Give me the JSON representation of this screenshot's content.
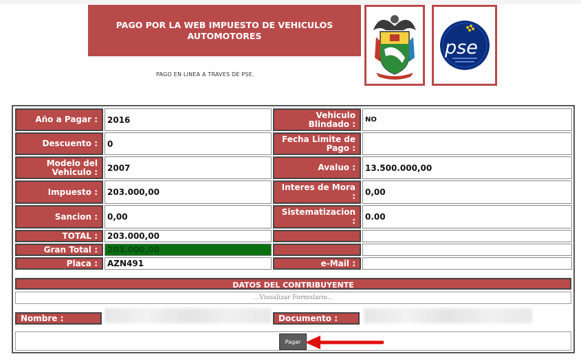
{
  "header": {
    "title": "PAGO POR LA WEB IMPUESTO DE VEHICULOS AUTOMOTORES",
    "subtitle": "PAGO EN LINEA A TRAVES DE PSE.",
    "pse_logo_text": "pse"
  },
  "form": {
    "left": [
      {
        "label": "Año a Pagar :",
        "value": "2016"
      },
      {
        "label": "Descuento :",
        "value": "0"
      },
      {
        "label": "Modelo del Vehiculo :",
        "value": "2007"
      },
      {
        "label": "Impuesto :",
        "value": "203.000,00"
      },
      {
        "label": "Sancion :",
        "value": "0,00"
      },
      {
        "label": "TOTAL :",
        "value": "203.000,00"
      },
      {
        "label": "Gran Total :",
        "value": "203.000,00"
      },
      {
        "label": "Placa :",
        "value": "AZN491"
      }
    ],
    "right": [
      {
        "label": "Vehiculo Blindado :",
        "value": "NO"
      },
      {
        "label": "Fecha Limite de Pago :",
        "value": ""
      },
      {
        "label": "Avaluo :",
        "value": "13.500.000,00"
      },
      {
        "label": "Interes de Mora :",
        "value": "0,00"
      },
      {
        "label": "Sistematizacion :",
        "value": "0.00"
      },
      {
        "label": "",
        "value": ""
      },
      {
        "label": "",
        "value": ""
      },
      {
        "label": "e-Mail :",
        "value": ""
      }
    ]
  },
  "contribuyente": {
    "header": "DATOS DEL CONTRIBUYENTE",
    "visualize_link": "...Visualizar Formulario...",
    "nombre_label": "Nombre :",
    "documento_label": "Documento :",
    "pay_button": "Pagar"
  },
  "colors": {
    "accent": "#b94a4a",
    "green_total": "#0a6f11",
    "arrow": "#e01010"
  }
}
